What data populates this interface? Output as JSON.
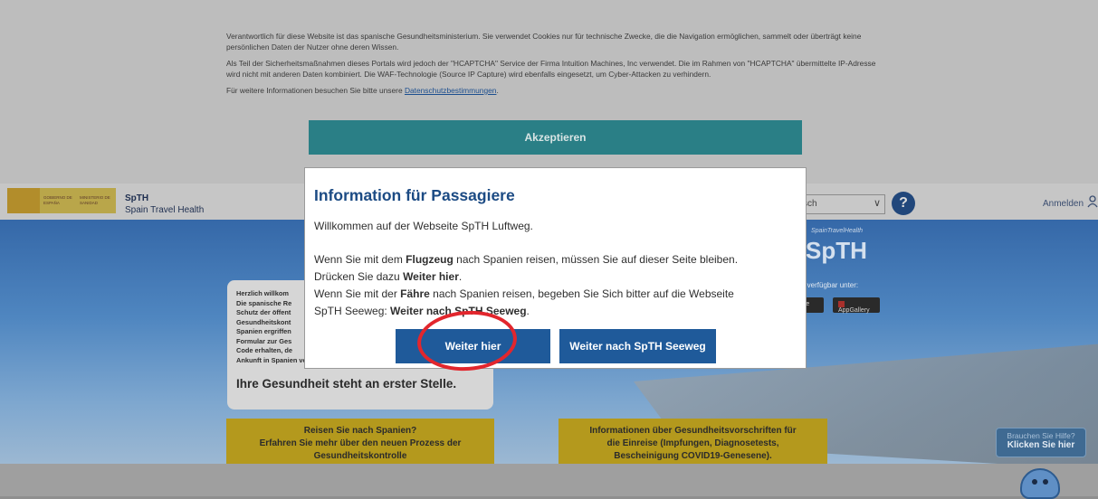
{
  "cookie_banner": {
    "paragraph1": "Verantwortlich für diese Website ist das spanische Gesundheitsministerium. Sie verwendet Cookies nur für technische Zwecke, die die Navigation ermöglichen, sammelt oder überträgt keine persönlichen Daten der Nutzer ohne deren Wissen.",
    "paragraph2": "Als Teil der Sicherheitsmaßnahmen dieses Portals wird jedoch der \"HCAPTCHA\" Service der Firma Intuition Machines, Inc verwendet. Die im Rahmen von \"HCAPTCHA\" übermittelte IP-Adresse wird nicht mit anderen Daten kombiniert. Die WAF-Technologie (Source IP Capture) wird ebenfalls eingesetzt, um Cyber-Attacken zu verhindern.",
    "paragraph3_prefix": "Für weitere Informationen besuchen Sie bitte unsere ",
    "privacy_link": "Datenschutzbestimmungen",
    "paragraph3_suffix": ".",
    "accept_label": "Akzeptieren"
  },
  "header": {
    "gov_text1": "GOBIERNO DE ESPAÑA",
    "gov_text2": "MINISTERIO DE SANIDAD",
    "brand_name": "SpTH",
    "brand_sub": "Spain Travel Health",
    "language_value": "sch",
    "help_icon": "?",
    "login_label": "Anmelden"
  },
  "hero": {
    "logo_caption": "SpainTravelHealth",
    "logo_text": "SpTH",
    "available_text": "r, verfügbar unter:",
    "store_left": "re",
    "store_right": "AppGallery"
  },
  "welcome": {
    "lines": [
      "Herzlich willkom",
      "Die spanische Re",
      "Schutz der öffent",
      "Gesundheitskont",
      "Spanien ergriffen",
      "Formular zur Ges",
      "Code erhalten, de",
      "Ankunft in Spanien vorzulegen müssen."
    ],
    "headline": "Ihre Gesundheit steht an erster Stelle."
  },
  "cards": {
    "left": [
      "Reisen Sie nach Spanien?",
      "Erfahren Sie mehr über den neuen Prozess der",
      "Gesundheitskontrolle"
    ],
    "right": [
      "Informationen über Gesundheitsvorschriften für",
      "die Einreise (Impfungen, Diagnosetests,",
      "Bescheinigung COVID19-Genesene)."
    ]
  },
  "chat": {
    "line1": "Brauchen Sie Hilfe?",
    "line2": "Klicken Sie hier"
  },
  "modal": {
    "title": "Information für Passagiere",
    "intro": "Willkommen auf der Webseite SpTH Luftweg.",
    "line1_a": "Wenn Sie mit dem ",
    "line1_b": "Flugzeug",
    "line1_c": " nach Spanien reisen, müssen Sie auf dieser Seite bleiben.",
    "line2_a": "Drücken Sie dazu ",
    "line2_b": "Weiter hier",
    "line2_c": ".",
    "line3_a": "Wenn Sie mit der ",
    "line3_b": "Fähre",
    "line3_c": " nach Spanien reisen, begeben Sie Sich bitter auf die Webseite",
    "line4_a": "SpTH Seeweg: ",
    "line4_b": "Weiter nach SpTH Seeweg",
    "line4_c": ".",
    "primary_button": "Weiter hier",
    "secondary_button": "Weiter nach SpTH Seeweg"
  },
  "colors": {
    "modal_title": "#1c4b84",
    "modal_button": "#1f5a9a",
    "accept_button": "#2a7f86",
    "card_yellow": "#b4991d",
    "annotation": "#e2262d"
  }
}
